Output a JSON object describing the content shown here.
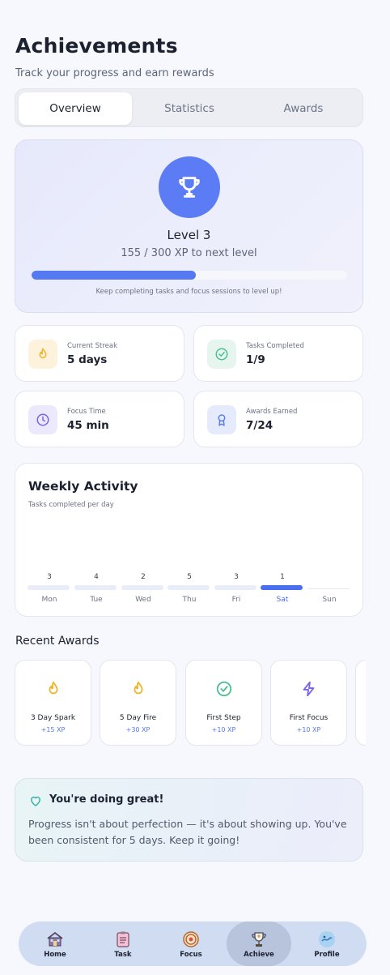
{
  "header": {
    "title": "Achievements",
    "subtitle": "Track your progress and earn rewards"
  },
  "tabs": [
    {
      "label": "Overview",
      "active": true
    },
    {
      "label": "Statistics",
      "active": false
    },
    {
      "label": "Awards",
      "active": false
    }
  ],
  "level": {
    "title": "Level 3",
    "xp_text": "155 / 300 XP to next level",
    "progress_fraction": 0.52,
    "hint": "Keep completing tasks and focus sessions to level up!",
    "icon": "trophy-icon",
    "accent": "#5b7cf4"
  },
  "stats": [
    {
      "label": "Current Streak",
      "value": "5 days",
      "icon": "flame-icon",
      "bg": "#fdf3dc",
      "color": "#f0b52e"
    },
    {
      "label": "Tasks Completed",
      "value": "1/9",
      "icon": "check-circle-icon",
      "bg": "#e6f6ef",
      "color": "#4cbf94"
    },
    {
      "label": "Focus Time",
      "value": "45 min",
      "icon": "clock-icon",
      "bg": "#ede9fc",
      "color": "#7a63e6"
    },
    {
      "label": "Awards Earned",
      "value": "7/24",
      "icon": "ribbon-icon",
      "bg": "#e6ebfb",
      "color": "#5b7cf4"
    }
  ],
  "weekly": {
    "title": "Weekly Activity",
    "subtitle": "Tasks completed per day",
    "days": [
      {
        "day": "Mon",
        "count": "3"
      },
      {
        "day": "Tue",
        "count": "4"
      },
      {
        "day": "Wed",
        "count": "2"
      },
      {
        "day": "Thu",
        "count": "5"
      },
      {
        "day": "Fri",
        "count": "3"
      },
      {
        "day": "Sat",
        "count": "1",
        "highlight": true
      },
      {
        "day": "Sun",
        "count": ""
      }
    ]
  },
  "recent_awards": {
    "title": "Recent Awards",
    "items": [
      {
        "name": "3 Day Spark",
        "xp": "+15 XP",
        "icon": "flame-icon"
      },
      {
        "name": "5 Day Fire",
        "xp": "+30 XP",
        "icon": "flame-icon"
      },
      {
        "name": "First Step",
        "xp": "+10 XP",
        "icon": "check-circle-icon"
      },
      {
        "name": "First Focus",
        "xp": "+10 XP",
        "icon": "lightning-icon"
      }
    ]
  },
  "encouragement": {
    "title": "You're doing great!",
    "text": "Progress isn't about perfection — it's about showing up. You've been consistent for 5 days. Keep it going!"
  },
  "nav": [
    {
      "label": "Home",
      "icon": "house-icon"
    },
    {
      "label": "Task",
      "icon": "clipboard-icon"
    },
    {
      "label": "Focus",
      "icon": "target-icon"
    },
    {
      "label": "Achieve",
      "icon": "trophy-icon",
      "active": true
    },
    {
      "label": "Profile",
      "icon": "profile-icon"
    }
  ]
}
